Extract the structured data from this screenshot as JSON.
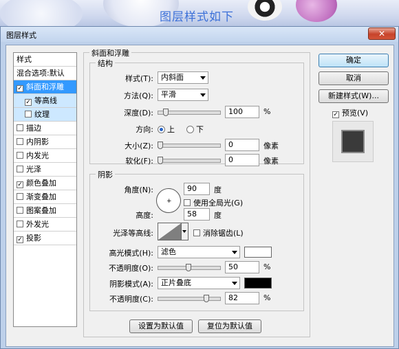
{
  "background": {
    "overlay_text": "图层样式如下"
  },
  "window": {
    "title": "图层样式",
    "close": "✕"
  },
  "stylelist": {
    "header": "样式",
    "blend": "混合选项:默认",
    "items": [
      {
        "label": "斜面和浮雕",
        "checked": true
      },
      {
        "label": "等高线",
        "checked": true
      },
      {
        "label": "纹理",
        "checked": false
      },
      {
        "label": "描边",
        "checked": false
      },
      {
        "label": "内阴影",
        "checked": false
      },
      {
        "label": "内发光",
        "checked": false
      },
      {
        "label": "光泽",
        "checked": false
      },
      {
        "label": "颜色叠加",
        "checked": true
      },
      {
        "label": "渐变叠加",
        "checked": false
      },
      {
        "label": "图案叠加",
        "checked": false
      },
      {
        "label": "外发光",
        "checked": false
      },
      {
        "label": "投影",
        "checked": true
      }
    ]
  },
  "bevel": {
    "group_title": "斜面和浮雕",
    "structure_title": "结构",
    "style_label": "样式(T):",
    "style_value": "内斜面",
    "technique_label": "方法(Q):",
    "technique_value": "平滑",
    "depth_label": "深度(D):",
    "depth_value": "100",
    "depth_unit": "%",
    "depth_fraction": 0.1,
    "direction_label": "方向:",
    "dir_up": "上",
    "dir_down": "下",
    "direction_selected": "上",
    "size_label": "大小(Z):",
    "size_value": "0",
    "size_unit": "像素",
    "size_fraction": 0.0,
    "soften_label": "软化(F):",
    "soften_value": "0",
    "soften_unit": "像素",
    "soften_fraction": 0.0
  },
  "shading": {
    "title": "阴影",
    "angle_label": "角度(N):",
    "angle_value": "90",
    "angle_unit": "度",
    "global_light_label": "使用全局光(G)",
    "global_light_checked": false,
    "altitude_label": "高度:",
    "altitude_value": "58",
    "altitude_unit": "度",
    "gloss_label": "光泽等高线:",
    "antialias_label": "消除锯齿(L)",
    "antialias_checked": false,
    "highlight_mode_label": "高光模式(H):",
    "highlight_mode_value": "滤色",
    "highlight_color": "#ffffff",
    "highlight_opacity_label": "不透明度(O):",
    "highlight_opacity_value": "50",
    "highlight_opacity_unit": "%",
    "highlight_opacity_fraction": 0.5,
    "shadow_mode_label": "阴影模式(A):",
    "shadow_mode_value": "正片叠底",
    "shadow_color": "#000000",
    "shadow_opacity_label": "不透明度(C):",
    "shadow_opacity_value": "82",
    "shadow_opacity_unit": "%",
    "shadow_opacity_fraction": 0.82
  },
  "footer": {
    "make_default": "设置为默认值",
    "reset_default": "复位为默认值"
  },
  "actions": {
    "ok": "确定",
    "cancel": "取消",
    "new_style": "新建样式(W)...",
    "preview_label": "预览(V)",
    "preview_checked": true
  }
}
